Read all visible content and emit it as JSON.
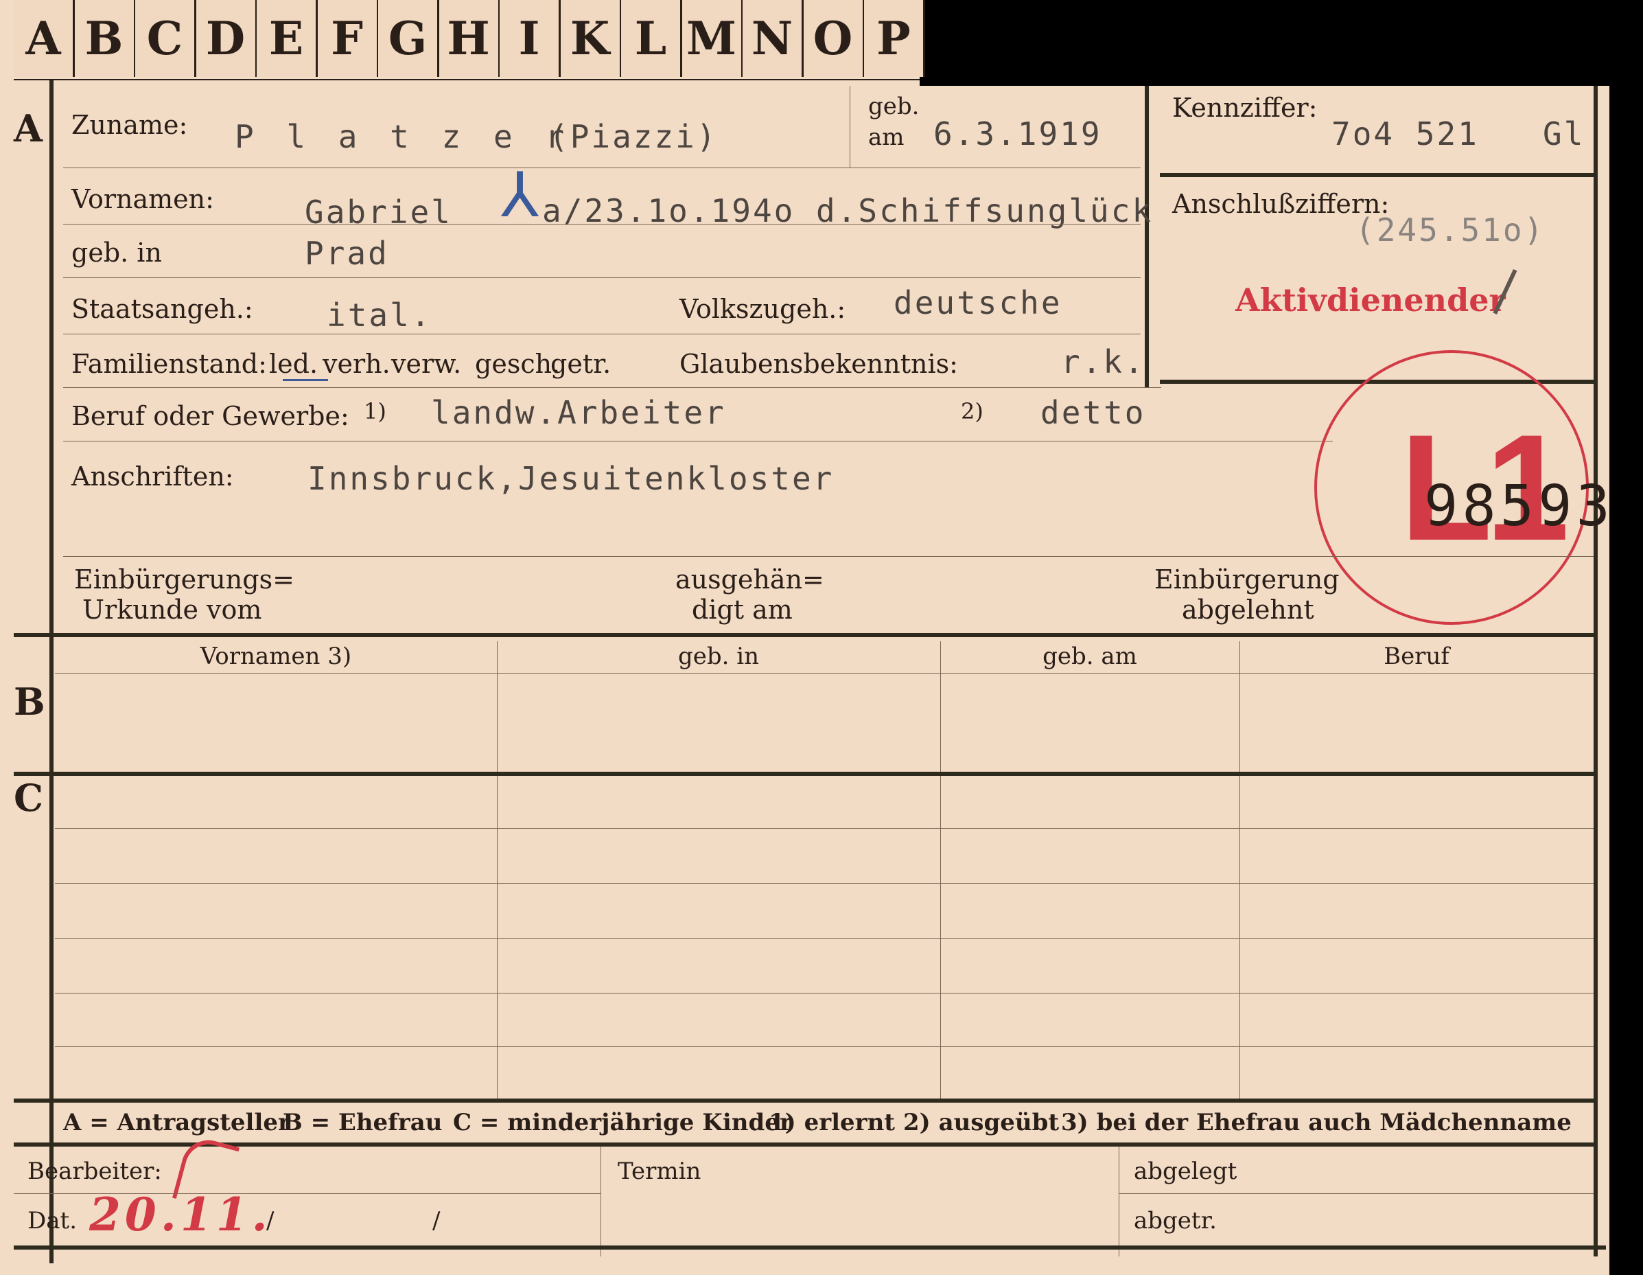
{
  "tabs": [
    "A",
    "B",
    "C",
    "D",
    "E",
    "F",
    "G",
    "H",
    "I",
    "K",
    "L",
    "M",
    "N",
    "O",
    "P"
  ],
  "sections": {
    "a": "A",
    "b": "B",
    "c": "C"
  },
  "labels": {
    "zuname": "Zuname:",
    "geb_am_1": "geb.",
    "geb_am_2": "am",
    "kennziffer": "Kennziffer:",
    "vornamen": "Vornamen:",
    "anschlussziffern": "Anschlußziffern:",
    "geb_in": "geb. in",
    "staatsangeh": "Staatsangeh.:",
    "volkszugeh": "Volkszugeh.:",
    "familienstand": "Familienstand:",
    "familienstand_options": [
      "led.",
      "verh.",
      "verw.",
      "gesch.",
      "getr."
    ],
    "glaubensbekenntnis": "Glaubensbekenntnis:",
    "beruf": "Beruf oder Gewerbe:",
    "beruf_note1": "1)",
    "beruf_note2": "2)",
    "anschriften": "Anschriften:",
    "einb_urkunde_1": "Einbürgerungs=",
    "einb_urkunde_2": "Urkunde vom",
    "ausgehaendigt_1": "ausgehän=",
    "ausgehaendigt_2": "digt am",
    "einb_abgelehnt_1": "Einbürgerung",
    "einb_abgelehnt_2": "abgelehnt"
  },
  "values": {
    "zuname": "P l a t z e r",
    "zuname_alt": "(Piazzi)",
    "geb_am": "6.3.1919",
    "kennziffer": "7o4 521",
    "kennziffer_suffix": "Gl",
    "vornamen": "Gabriel",
    "vornamen_note": "a/23.1o.194o d.Schiffsunglück",
    "geb_in": "Prad",
    "anschlussziffern": "(245.51o)",
    "staatsangeh": "ital.",
    "volkszugeh": "deutsche",
    "glaubensbekenntnis": "r.k.",
    "beruf_1": "landw.Arbeiter",
    "beruf_2": "detto",
    "anschriften": "Innsbruck,Jesuitenkloster",
    "stamp_letter": "L1",
    "stamp_number": "98593",
    "stamp_red_text": "Aktivdienender"
  },
  "table_b": {
    "columns": [
      "Vornamen 3)",
      "geb. in",
      "geb. am",
      "Beruf"
    ]
  },
  "legend": [
    "A = Antragsteller",
    "B = Ehefrau",
    "C = minderjährige Kinder",
    "1) erlernt",
    "2) ausgeübt",
    "3) bei der Ehefrau auch Mädchenname"
  ],
  "footer": {
    "bearbeiter": "Bearbeiter:",
    "dat": "Dat.",
    "dat_value": "20.11.",
    "dat_slash": "/",
    "termin": "Termin",
    "abgelegt": "abgelegt",
    "abgetr": "abgetr."
  },
  "colors": {
    "paper": "#f3dcc6",
    "ink": "#2a1e18",
    "stamp_red": "#d23a45",
    "typewriter": "#4d4540"
  }
}
